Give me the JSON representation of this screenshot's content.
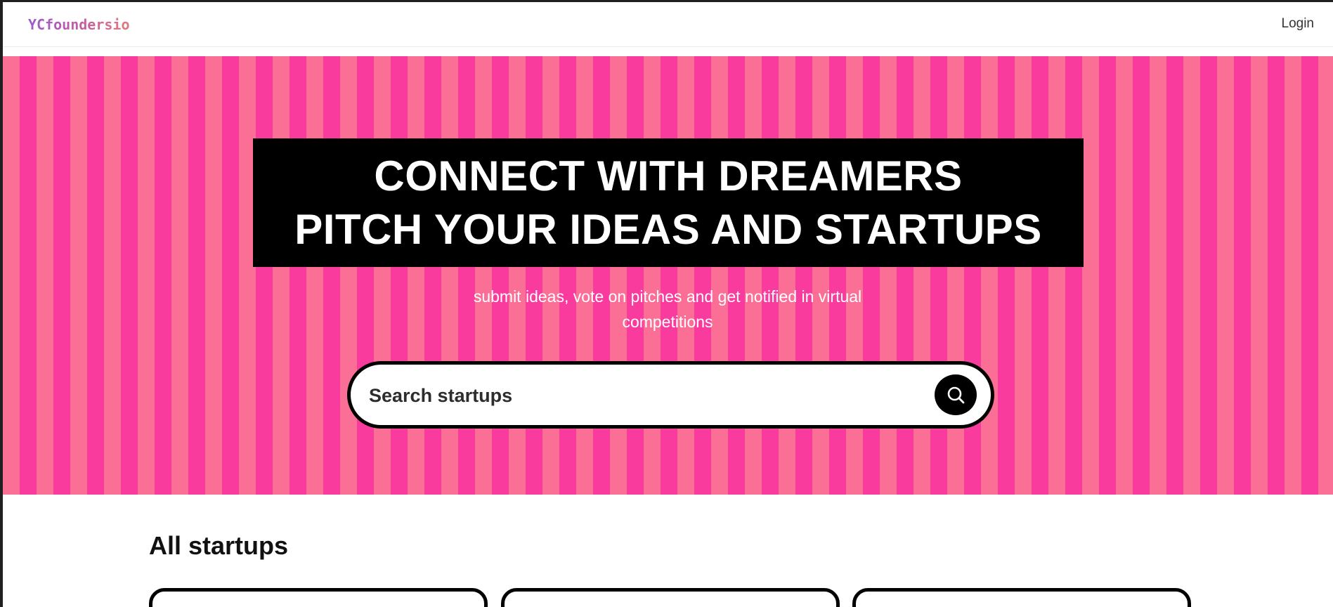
{
  "navbar": {
    "logo": "YCfoundersio",
    "login_label": "Login"
  },
  "hero": {
    "headline_lines": [
      "CONNECT WITH DREAMERS",
      "PITCH YOUR IDEAS AND STARTUPS"
    ],
    "subtitle_lines": [
      "submit ideas, vote on pitches and get notified in virtual",
      "competitions"
    ],
    "stripe_colors": [
      "#fb6f97",
      "#fa3b9e"
    ]
  },
  "search": {
    "placeholder": "Search startups",
    "icon": "search-icon"
  },
  "startups": {
    "section_title": "All startups"
  }
}
